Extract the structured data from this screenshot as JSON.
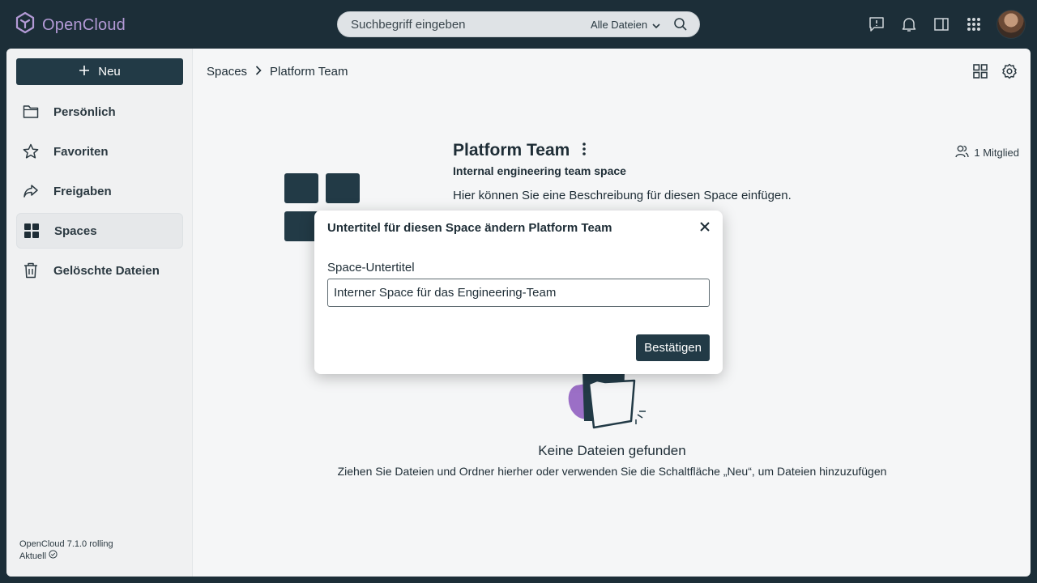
{
  "app": {
    "name": "OpenCloud"
  },
  "search": {
    "placeholder": "Suchbegriff eingeben",
    "scope": "Alle Dateien"
  },
  "topbar": {
    "icons": [
      "feedback-icon",
      "bell-icon",
      "sidebar-toggle-icon",
      "apps-grid-icon"
    ]
  },
  "sidebar": {
    "new_label": "Neu",
    "items": [
      {
        "label": "Persönlich",
        "icon": "folder-icon"
      },
      {
        "label": "Favoriten",
        "icon": "star-icon"
      },
      {
        "label": "Freigaben",
        "icon": "share-icon"
      },
      {
        "label": "Spaces",
        "icon": "spaces-icon",
        "active": true
      },
      {
        "label": "Gelöschte Dateien",
        "icon": "trash-icon"
      }
    ],
    "version": "OpenCloud 7.1.0 rolling",
    "status": "Aktuell"
  },
  "breadcrumb": {
    "root": "Spaces",
    "current": "Platform Team"
  },
  "space": {
    "title": "Platform Team",
    "subtitle": "Internal engineering team space",
    "description": "Hier können Sie eine Beschreibung für diesen Space einfügen.",
    "members": "1 Mitglied"
  },
  "empty": {
    "title": "Keine Dateien gefunden",
    "message": "Ziehen Sie Dateien und Ordner hierher oder verwenden Sie die Schaltfläche „Neu“, um Dateien hinzuzufügen"
  },
  "modal": {
    "title": "Untertitel für diesen Space ändern Platform Team",
    "field_label": "Space-Untertitel",
    "field_value": "Interner Space für das Engineering-Team",
    "confirm_label": "Bestätigen"
  },
  "colors": {
    "primary": "#223a46",
    "topbar": "#1c2e38",
    "brand": "#b39ad6",
    "accent": "#9b6fc6"
  }
}
